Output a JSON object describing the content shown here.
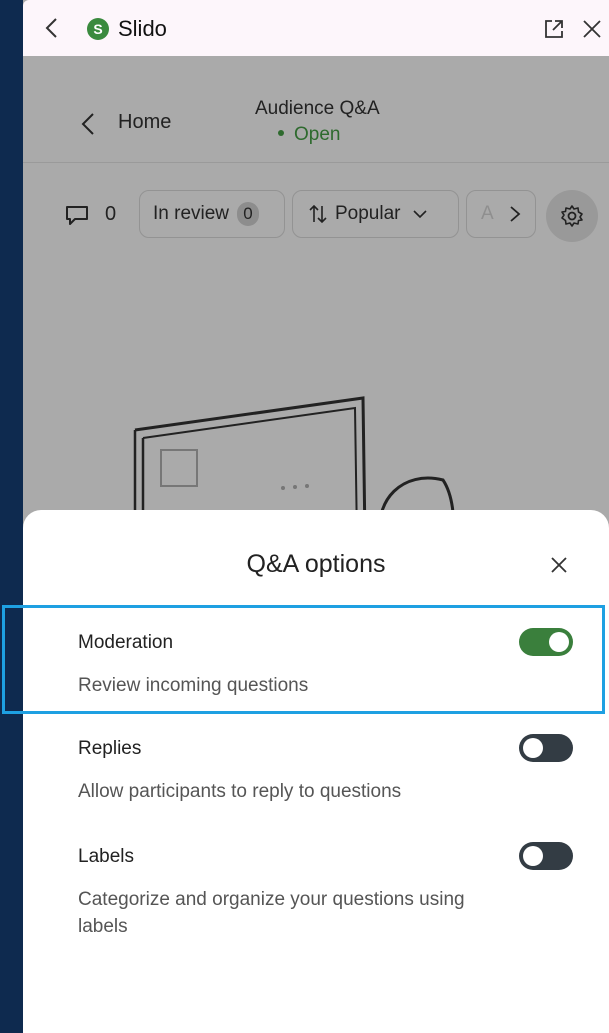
{
  "titlebar": {
    "app_name": "Slido",
    "logo_letter": "S"
  },
  "header": {
    "back_label": "Home",
    "session_title": "Audience Q&A",
    "session_status": "Open"
  },
  "filters": {
    "comment_count": "0",
    "in_review_label": "In review",
    "in_review_count": "0",
    "sort_label": "Popular",
    "more_label": "A"
  },
  "sheet": {
    "title": "Q&A options",
    "options": [
      {
        "label": "Moderation",
        "description": "Review incoming questions",
        "enabled": true
      },
      {
        "label": "Replies",
        "description": "Allow participants to reply to questions",
        "enabled": false
      },
      {
        "label": "Labels",
        "description": "Categorize and organize your questions using labels",
        "enabled": false
      }
    ]
  },
  "colors": {
    "accent_green": "#3a7f3c",
    "toggle_off": "#333c44",
    "highlight": "#1ea0e2",
    "background": "#0e2a4f"
  }
}
